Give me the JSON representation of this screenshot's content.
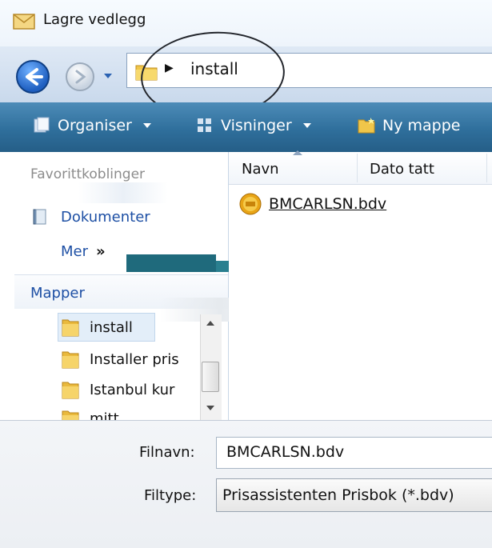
{
  "window": {
    "title": "Lagre vedlegg"
  },
  "address_bar": {
    "segment": "install"
  },
  "toolbar": {
    "organise_label": "Organiser",
    "views_label": "Visninger",
    "new_folder_label": "Ny mappe"
  },
  "nav_pane": {
    "favorites_heading": "Favorittkoblinger",
    "documents_label": "Dokumenter",
    "more_label": "Mer",
    "more_chevron": "»",
    "folders_label": "Mapper",
    "folders": [
      "install",
      "Installer pris",
      "Istanbul kur",
      "mitt"
    ]
  },
  "file_list": {
    "columns": [
      "Navn",
      "Dato tatt"
    ],
    "files": [
      {
        "name": "BMCARLSN.bdv"
      }
    ]
  },
  "form": {
    "filename_label": "Filnavn:",
    "filename_value": "BMCARLSN.bdv",
    "filetype_label": "Filtype:",
    "filetype_value": "Prisassistenten Prisbok (*.bdv)"
  },
  "colors": {
    "toolbar": "#2f6f9c",
    "link": "#1d4fa4",
    "selection": "#e3eef9"
  },
  "icons": {
    "title": "envelope-icon",
    "back": "back-arrow-icon",
    "forward": "forward-arrow-icon",
    "folder": "folder-icon",
    "file": "prisbok-file-icon"
  }
}
